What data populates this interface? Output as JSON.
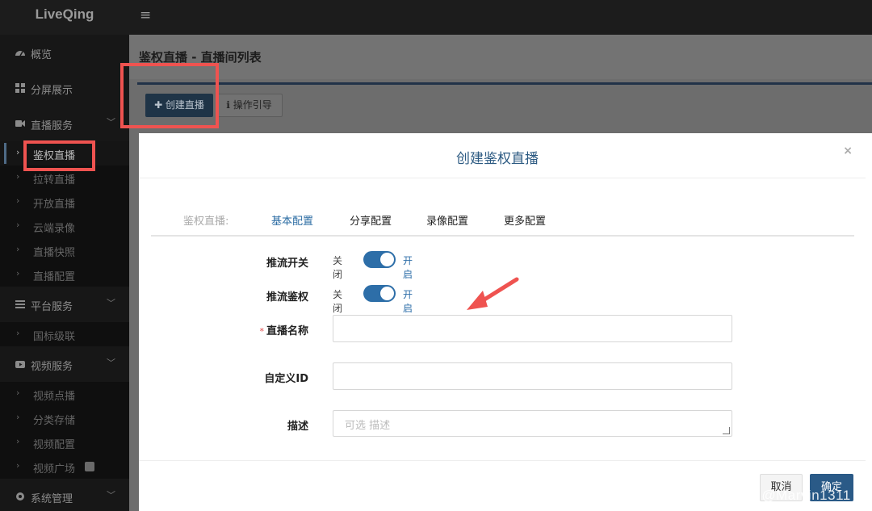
{
  "app": {
    "brand": "LiveQing",
    "menu_icon": "hamburger-icon"
  },
  "sidebar": {
    "groups": [
      {
        "label": "概览",
        "icon": "dashboard-icon"
      },
      {
        "label": "分屏展示",
        "icon": "grid-icon"
      },
      {
        "label": "直播服务",
        "icon": "video-camera-icon",
        "items": [
          "鉴权直播",
          "拉转直播",
          "开放直播",
          "云端录像",
          "直播快照",
          "直播配置"
        ]
      },
      {
        "label": "平台服务",
        "icon": "server-icon",
        "items": [
          "国标级联"
        ]
      },
      {
        "label": "视频服务",
        "icon": "youtube-icon",
        "items": [
          "视频点播",
          "分类存储",
          "视频配置",
          "视频广场"
        ]
      },
      {
        "label": "系统管理",
        "icon": "gear-icon"
      }
    ]
  },
  "page": {
    "title": "鉴权直播 - 直播间列表",
    "create_button": "✚ 创建直播",
    "guide_button": "操作引导"
  },
  "modal": {
    "title": "创建鉴权直播",
    "close": "×",
    "tab_prefix": "鉴权直播:",
    "tabs": [
      "基本配置",
      "分享配置",
      "录像配置",
      "更多配置"
    ],
    "push_switch_label": "推流开关",
    "push_auth_label": "推流鉴权",
    "off_text": "关闭",
    "on_text": "开启",
    "push_switch_on": true,
    "push_auth_on": true,
    "name_label": "直播名称",
    "name_required": "*",
    "name_value": "",
    "custom_id_label": "自定义ID",
    "custom_id_value": "",
    "desc_label": "描述",
    "desc_placeholder": "可选 描述",
    "cancel": "取消",
    "ok": "确定"
  },
  "watermark": "CSDN @Marvin1311",
  "colors": {
    "accent": "#2b6ca3",
    "highlight": "#ef5350",
    "sidebar_bg": "#171717"
  }
}
